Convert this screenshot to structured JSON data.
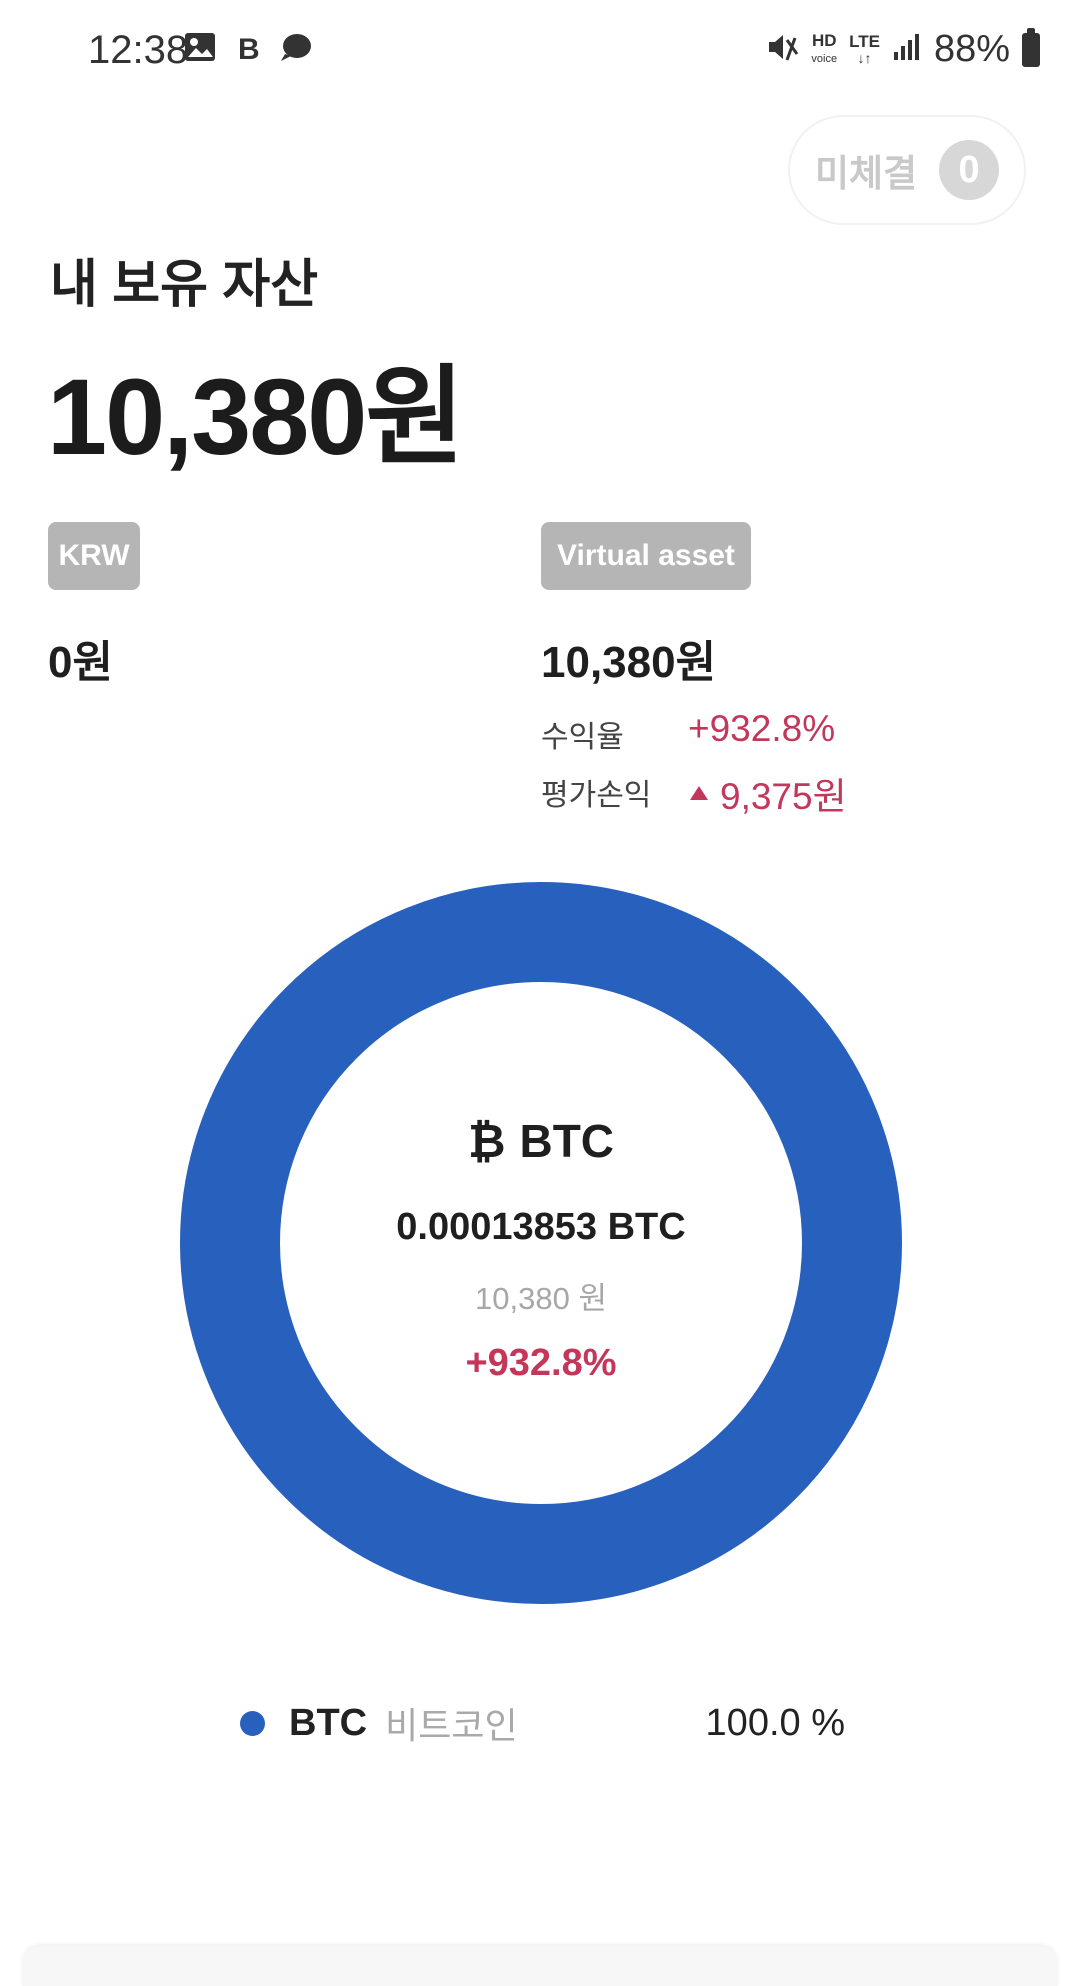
{
  "status_bar": {
    "time": "12:38",
    "battery": "88%",
    "network_label": "HD\nvoice",
    "lte_label": "LTE",
    "left_icons": [
      "gallery-icon",
      "b-app-icon",
      "chat-bubble-icon"
    ],
    "right_icons": [
      "mute-icon",
      "hd-voice-icon",
      "lte-icon",
      "signal-icon",
      "battery-icon"
    ]
  },
  "pending_orders": {
    "label": "미체결",
    "count": "0"
  },
  "portfolio": {
    "title": "내 보유 자산",
    "total": "10,380원",
    "krw": {
      "tag": "KRW",
      "amount": "0원"
    },
    "virtual_asset": {
      "tag": "Virtual asset",
      "amount": "10,380원",
      "return_label": "수익율",
      "return_value": "+932.8%",
      "pl_label": "평가손익",
      "pl_value": "9,375원"
    }
  },
  "chart_data": {
    "type": "pie",
    "variant": "donut",
    "categories": [
      "BTC"
    ],
    "values": [
      100.0
    ],
    "colors": [
      "#2860bd"
    ]
  },
  "donut_center": {
    "symbol": "₿",
    "code": "BTC",
    "quantity": "0.00013853 BTC",
    "krw_value": "10,380 원",
    "return": "+932.8%"
  },
  "legend": [
    {
      "code": "BTC",
      "name": "비트코인",
      "percent": "100.0 %",
      "color": "#2860bd"
    }
  ],
  "colors": {
    "accent_blue": "#2860bd",
    "profit_red": "#c2375a",
    "tag_gray": "#b5b5b5"
  }
}
